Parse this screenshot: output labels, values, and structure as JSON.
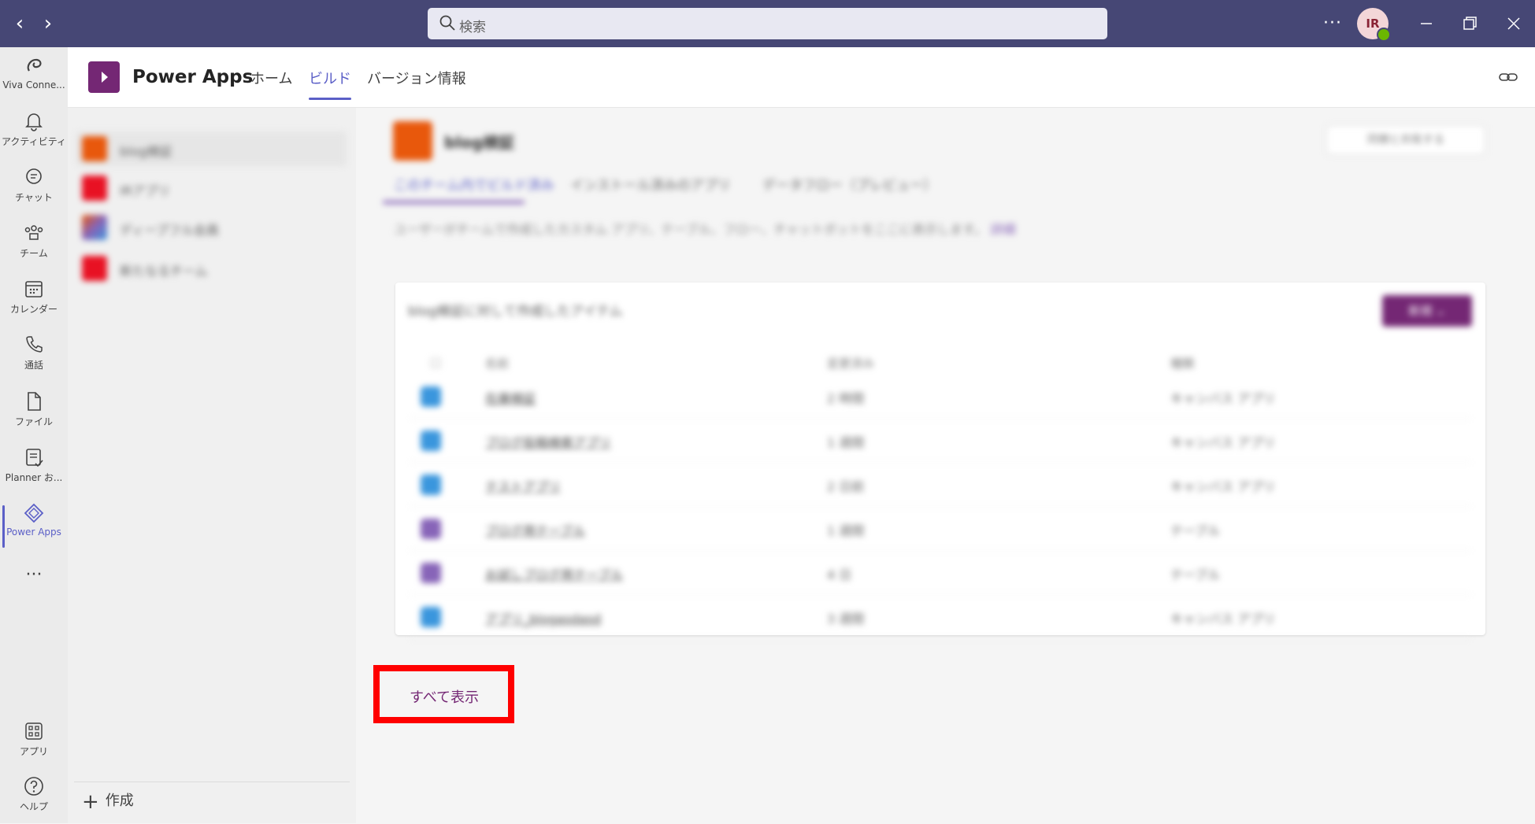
{
  "titlebar": {
    "search_placeholder": "検索",
    "more_label": "···",
    "avatar_initials": "IR"
  },
  "rail": {
    "items": [
      {
        "label": "Viva Conne...",
        "icon": "viva-connections-icon"
      },
      {
        "label": "アクティビティ",
        "icon": "bell-icon"
      },
      {
        "label": "チャット",
        "icon": "chat-icon"
      },
      {
        "label": "チーム",
        "icon": "teams-icon"
      },
      {
        "label": "カレンダー",
        "icon": "calendar-icon"
      },
      {
        "label": "通話",
        "icon": "phone-icon"
      },
      {
        "label": "ファイル",
        "icon": "file-icon"
      },
      {
        "label": "Planner お...",
        "icon": "planner-icon"
      },
      {
        "label": "Power Apps",
        "icon": "power-apps-icon"
      }
    ],
    "more": "···",
    "bottom": [
      {
        "label": "アプリ",
        "icon": "apps-icon"
      },
      {
        "label": "ヘルプ",
        "icon": "help-icon"
      }
    ]
  },
  "header": {
    "app_name": "Power Apps",
    "tabs": [
      "ホーム",
      "ビルド",
      "バージョン情報"
    ],
    "active_tab": "ビルド"
  },
  "sidepanel": {
    "items": [
      {
        "label": "blog検証",
        "color": "#e8580c"
      },
      {
        "label": "IRアプリ",
        "color": "#e81123"
      },
      {
        "label": "ディープフル会員",
        "color": "#8764b8"
      },
      {
        "label": "新たなるチーム",
        "color": "#e81123"
      }
    ],
    "create_label": "作成"
  },
  "main": {
    "team_name": "blog検証",
    "share_button": "同僚と共有する",
    "subtabs": [
      "このチーム内でビルド済み",
      "インストール済みのアプリ",
      "データフロー（プレビュー）"
    ],
    "description": "ユーザーがチームで作成したカスタム アプリ、テーブル、フロー、チャットボットをここに表示します。",
    "description_link": "詳細",
    "card_title": "blog検証に対して作成したアイテム",
    "new_button": "新規 ⌄",
    "columns": [
      "名前",
      "変更済み",
      "種類"
    ],
    "rows": [
      {
        "name": "在庫検証",
        "modified": "2 時間",
        "type": "キャンバス アプリ",
        "color": "#3a96dd"
      },
      {
        "name": "ブログ投稿検索アプリ",
        "modified": "1 週間",
        "type": "キャンバス アプリ",
        "color": "#3a96dd"
      },
      {
        "name": "テストアプリ",
        "modified": "2 日前",
        "type": "キャンバス アプリ",
        "color": "#3a96dd"
      },
      {
        "name": "ブログ用テーブル",
        "modified": "1 週間",
        "type": "テーブル",
        "color": "#8764b8"
      },
      {
        "name": "お試しブログ用テーブル",
        "modified": "4 日",
        "type": "テーブル",
        "color": "#8764b8"
      },
      {
        "name": "アプリ_blogasdasd",
        "modified": "3 週間",
        "type": "キャンバス アプリ",
        "color": "#3a96dd"
      }
    ],
    "show_all": "すべて表示"
  }
}
